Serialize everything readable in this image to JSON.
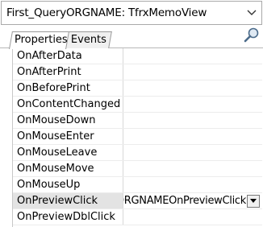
{
  "object_selector": {
    "value": "First_QueryORGNAME: TfrxMemoView"
  },
  "tabs": [
    {
      "label": "Properties",
      "active": true
    },
    {
      "label": "Events",
      "active": false
    }
  ],
  "events": [
    {
      "name": "OnAfterData",
      "value": ""
    },
    {
      "name": "OnAfterPrint",
      "value": ""
    },
    {
      "name": "OnBeforePrint",
      "value": ""
    },
    {
      "name": "OnContentChanged",
      "value": ""
    },
    {
      "name": "OnMouseDown",
      "value": ""
    },
    {
      "name": "OnMouseEnter",
      "value": ""
    },
    {
      "name": "OnMouseLeave",
      "value": ""
    },
    {
      "name": "OnMouseMove",
      "value": ""
    },
    {
      "name": "OnMouseUp",
      "value": ""
    },
    {
      "name": "OnPreviewClick",
      "value": "First_QueryORGNAMEOnPreviewClick",
      "selected": true
    },
    {
      "name": "OnPreviewDblClick",
      "value": ""
    }
  ],
  "icons": {
    "combo_arrow": "chevron-down-icon",
    "find": "magnifier-icon",
    "value_dropdown": "triangle-down-icon"
  }
}
